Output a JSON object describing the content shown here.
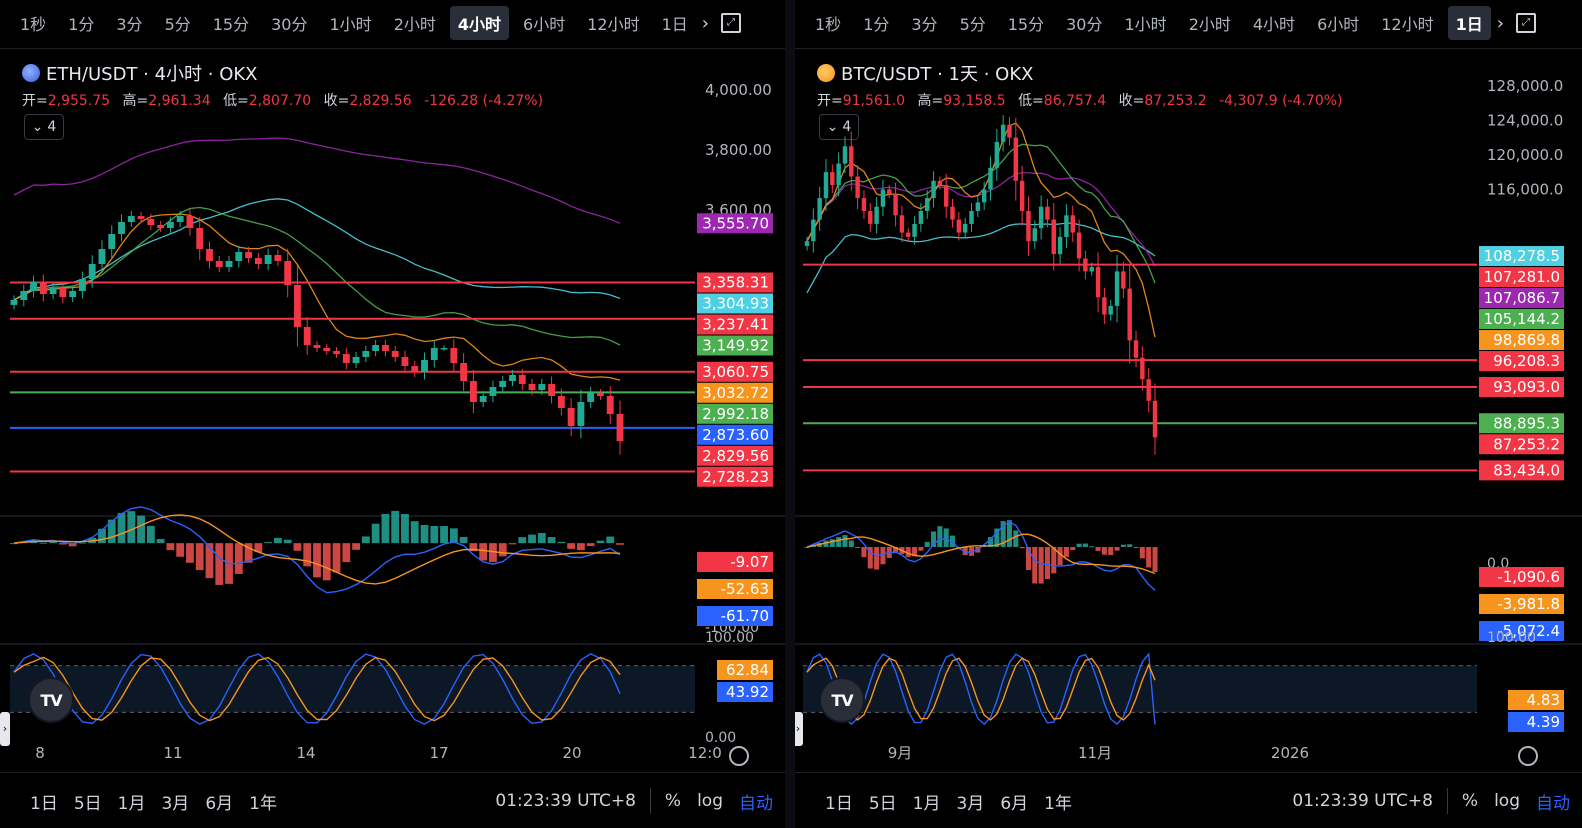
{
  "left": {
    "timeframes": [
      "1秒",
      "1分",
      "3分",
      "5分",
      "15分",
      "30分",
      "1小时",
      "2小时",
      "4小时",
      "6小时",
      "12小时",
      "1日"
    ],
    "active_timeframe": "4小时",
    "symbol": "ETH/USDT · 4小时 · OKX",
    "ohlc": {
      "open_label": "开=",
      "open": "2,955.75",
      "high_label": "高=",
      "high": "2,961.34",
      "low_label": "低=",
      "low": "2,807.70",
      "close_label": "收=",
      "close": "2,829.56",
      "change": "-126.28 (-4.27%)"
    },
    "indicator_count": "4",
    "bottom": {
      "ranges": [
        "1日",
        "5日",
        "1月",
        "3月",
        "6月",
        "1年"
      ],
      "clock": "01:23:39 UTC+8",
      "pct": "%",
      "log": "log",
      "auto": "自动"
    }
  },
  "right": {
    "timeframes": [
      "1秒",
      "1分",
      "3分",
      "5分",
      "15分",
      "30分",
      "1小时",
      "2小时",
      "4小时",
      "6小时",
      "12小时",
      "1日"
    ],
    "active_timeframe": "1日",
    "symbol": "BTC/USDT · 1天 · OKX",
    "ohlc": {
      "open_label": "开=",
      "open": "91,561.0",
      "high_label": "高=",
      "high": "93,158.5",
      "low_label": "低=",
      "low": "86,757.4",
      "close_label": "收=",
      "close": "87,253.2",
      "change": "-4,307.9 (-4.70%)"
    },
    "indicator_count": "4",
    "bottom": {
      "ranges": [
        "1日",
        "5日",
        "1月",
        "3月",
        "6月",
        "1年"
      ],
      "clock": "01:23:39 UTC+8",
      "pct": "%",
      "log": "log",
      "auto": "自动"
    }
  },
  "colors": {
    "up": "#22ab94",
    "down": "#f23645",
    "blue": "#2962ff",
    "orange": "#f7941d",
    "purple": "#9c27b0",
    "teal": "#4dd0e1",
    "green": "#4caf50",
    "grid": "#131722"
  },
  "chart_data": [
    {
      "id": "eth",
      "type": "candlestick",
      "title": "ETH/USDT · 4小时 · OKX",
      "ylim": [
        2600,
        4100
      ],
      "y_ticks": [
        4000,
        3800,
        3600
      ],
      "x_ticks": [
        "8",
        "11",
        "14",
        "17",
        "20",
        "12:0"
      ],
      "ohlc_close_series": [
        3300,
        3330,
        3360,
        3320,
        3340,
        3310,
        3330,
        3370,
        3420,
        3470,
        3520,
        3560,
        3580,
        3570,
        3550,
        3540,
        3560,
        3580,
        3540,
        3470,
        3430,
        3410,
        3430,
        3460,
        3440,
        3420,
        3450,
        3430,
        3350,
        3210,
        3150,
        3140,
        3130,
        3120,
        3090,
        3110,
        3130,
        3150,
        3130,
        3110,
        3080,
        3060,
        3100,
        3140,
        3140,
        3090,
        3030,
        2960,
        2980,
        3010,
        3030,
        3050,
        3020,
        3000,
        3020,
        2980,
        2940,
        2880,
        2960,
        2990,
        2980,
        2920,
        2829.56
      ],
      "moving_averages": [
        {
          "color": "purple",
          "last": 3555.7
        },
        {
          "color": "teal",
          "last": 3304.93
        },
        {
          "color": "green",
          "last": 3149.92
        },
        {
          "color": "orange",
          "last": 3032.72
        }
      ],
      "horizontal_lines": [
        {
          "value": 3358.31,
          "color": "red"
        },
        {
          "value": 3237.41,
          "color": "red"
        },
        {
          "value": 3060.75,
          "color": "red"
        },
        {
          "value": 2992.18,
          "color": "green"
        },
        {
          "value": 2873.6,
          "color": "blue"
        },
        {
          "value": 2728.23,
          "color": "red"
        }
      ],
      "price_labels": [
        {
          "text": "3,555.70",
          "color": "purple"
        },
        {
          "text": "3,358.31",
          "color": "red"
        },
        {
          "text": "3,304.93",
          "color": "teal"
        },
        {
          "text": "3,237.41",
          "color": "red"
        },
        {
          "text": "3,149.92",
          "color": "green"
        },
        {
          "text": "3,060.75",
          "color": "red"
        },
        {
          "text": "3,032.72",
          "color": "orange"
        },
        {
          "text": "2,992.18",
          "color": "green"
        },
        {
          "text": "2,873.60",
          "color": "blue"
        },
        {
          "text": "2,829.56",
          "color": "red"
        },
        {
          "text": "2,728.23",
          "color": "red"
        }
      ],
      "macd": {
        "ylim": [
          -110,
          30
        ],
        "labels": [
          {
            "text": "-9.07",
            "color": "red"
          },
          {
            "text": "-52.63",
            "color": "orange"
          },
          {
            "text": "-61.70",
            "color": "blue"
          }
        ],
        "tick": "-100.00"
      },
      "stoch": {
        "ylim": [
          0,
          100
        ],
        "labels": [
          {
            "text": "62.84",
            "color": "orange"
          },
          {
            "text": "43.92",
            "color": "blue"
          }
        ],
        "ticks": [
          "100.00",
          "0.00"
        ]
      }
    },
    {
      "id": "btc",
      "type": "candlestick",
      "title": "BTC/USDT · 1天 · OKX",
      "ylim": [
        80000,
        131000
      ],
      "y_ticks": [
        128000,
        124000,
        120000,
        116000
      ],
      "x_ticks": [
        "9月",
        "11月",
        "2026"
      ],
      "ohlc_close_series": [
        110000,
        112500,
        115000,
        118000,
        116500,
        119000,
        121000,
        117500,
        115000,
        113500,
        112000,
        114000,
        116000,
        115500,
        113000,
        111000,
        110500,
        112000,
        113500,
        115000,
        117000,
        116500,
        114000,
        112500,
        111000,
        112000,
        113500,
        114500,
        116000,
        118500,
        121500,
        123500,
        122000,
        117000,
        113500,
        110000,
        111500,
        114000,
        112500,
        108500,
        110500,
        113000,
        111000,
        108000,
        106500,
        107000,
        103500,
        101500,
        102500,
        106500,
        104500,
        98500,
        96500,
        94000,
        91500,
        87253.2
      ],
      "moving_averages": [
        {
          "color": "teal",
          "last": 108278.5
        },
        {
          "color": "purple",
          "last": 107086.7
        },
        {
          "color": "green",
          "last": 105144.2
        },
        {
          "color": "orange",
          "last": 98869.8
        }
      ],
      "horizontal_lines": [
        {
          "value": 107281.0,
          "color": "red"
        },
        {
          "value": 96208.3,
          "color": "red"
        },
        {
          "value": 93093.0,
          "color": "red"
        },
        {
          "value": 88895.3,
          "color": "green"
        },
        {
          "value": 83434.0,
          "color": "red"
        }
      ],
      "price_labels": [
        {
          "text": "108,278.5",
          "color": "teal"
        },
        {
          "text": "107,281.0",
          "color": "red"
        },
        {
          "text": "107,086.7",
          "color": "purple"
        },
        {
          "text": "105,144.2",
          "color": "green"
        },
        {
          "text": "98,869.8",
          "color": "orange"
        },
        {
          "text": "96,208.3",
          "color": "red"
        },
        {
          "text": "93,093.0",
          "color": "red"
        },
        {
          "text": "88,895.3",
          "color": "green"
        },
        {
          "text": "87,253.2",
          "color": "red"
        },
        {
          "text": "83,434.0",
          "color": "red"
        }
      ],
      "macd": {
        "ylim": [
          -6000,
          2000
        ],
        "labels": [
          {
            "text": "-1,090.6",
            "color": "red"
          },
          {
            "text": "-3,981.8",
            "color": "orange"
          },
          {
            "text": "-5,072.4",
            "color": "blue"
          }
        ],
        "tick": "0.0"
      },
      "stoch": {
        "ylim": [
          0,
          100
        ],
        "labels": [
          {
            "text": "4.83",
            "color": "orange"
          },
          {
            "text": "4.39",
            "color": "blue"
          }
        ],
        "ticks": [
          "100.00"
        ]
      }
    }
  ]
}
